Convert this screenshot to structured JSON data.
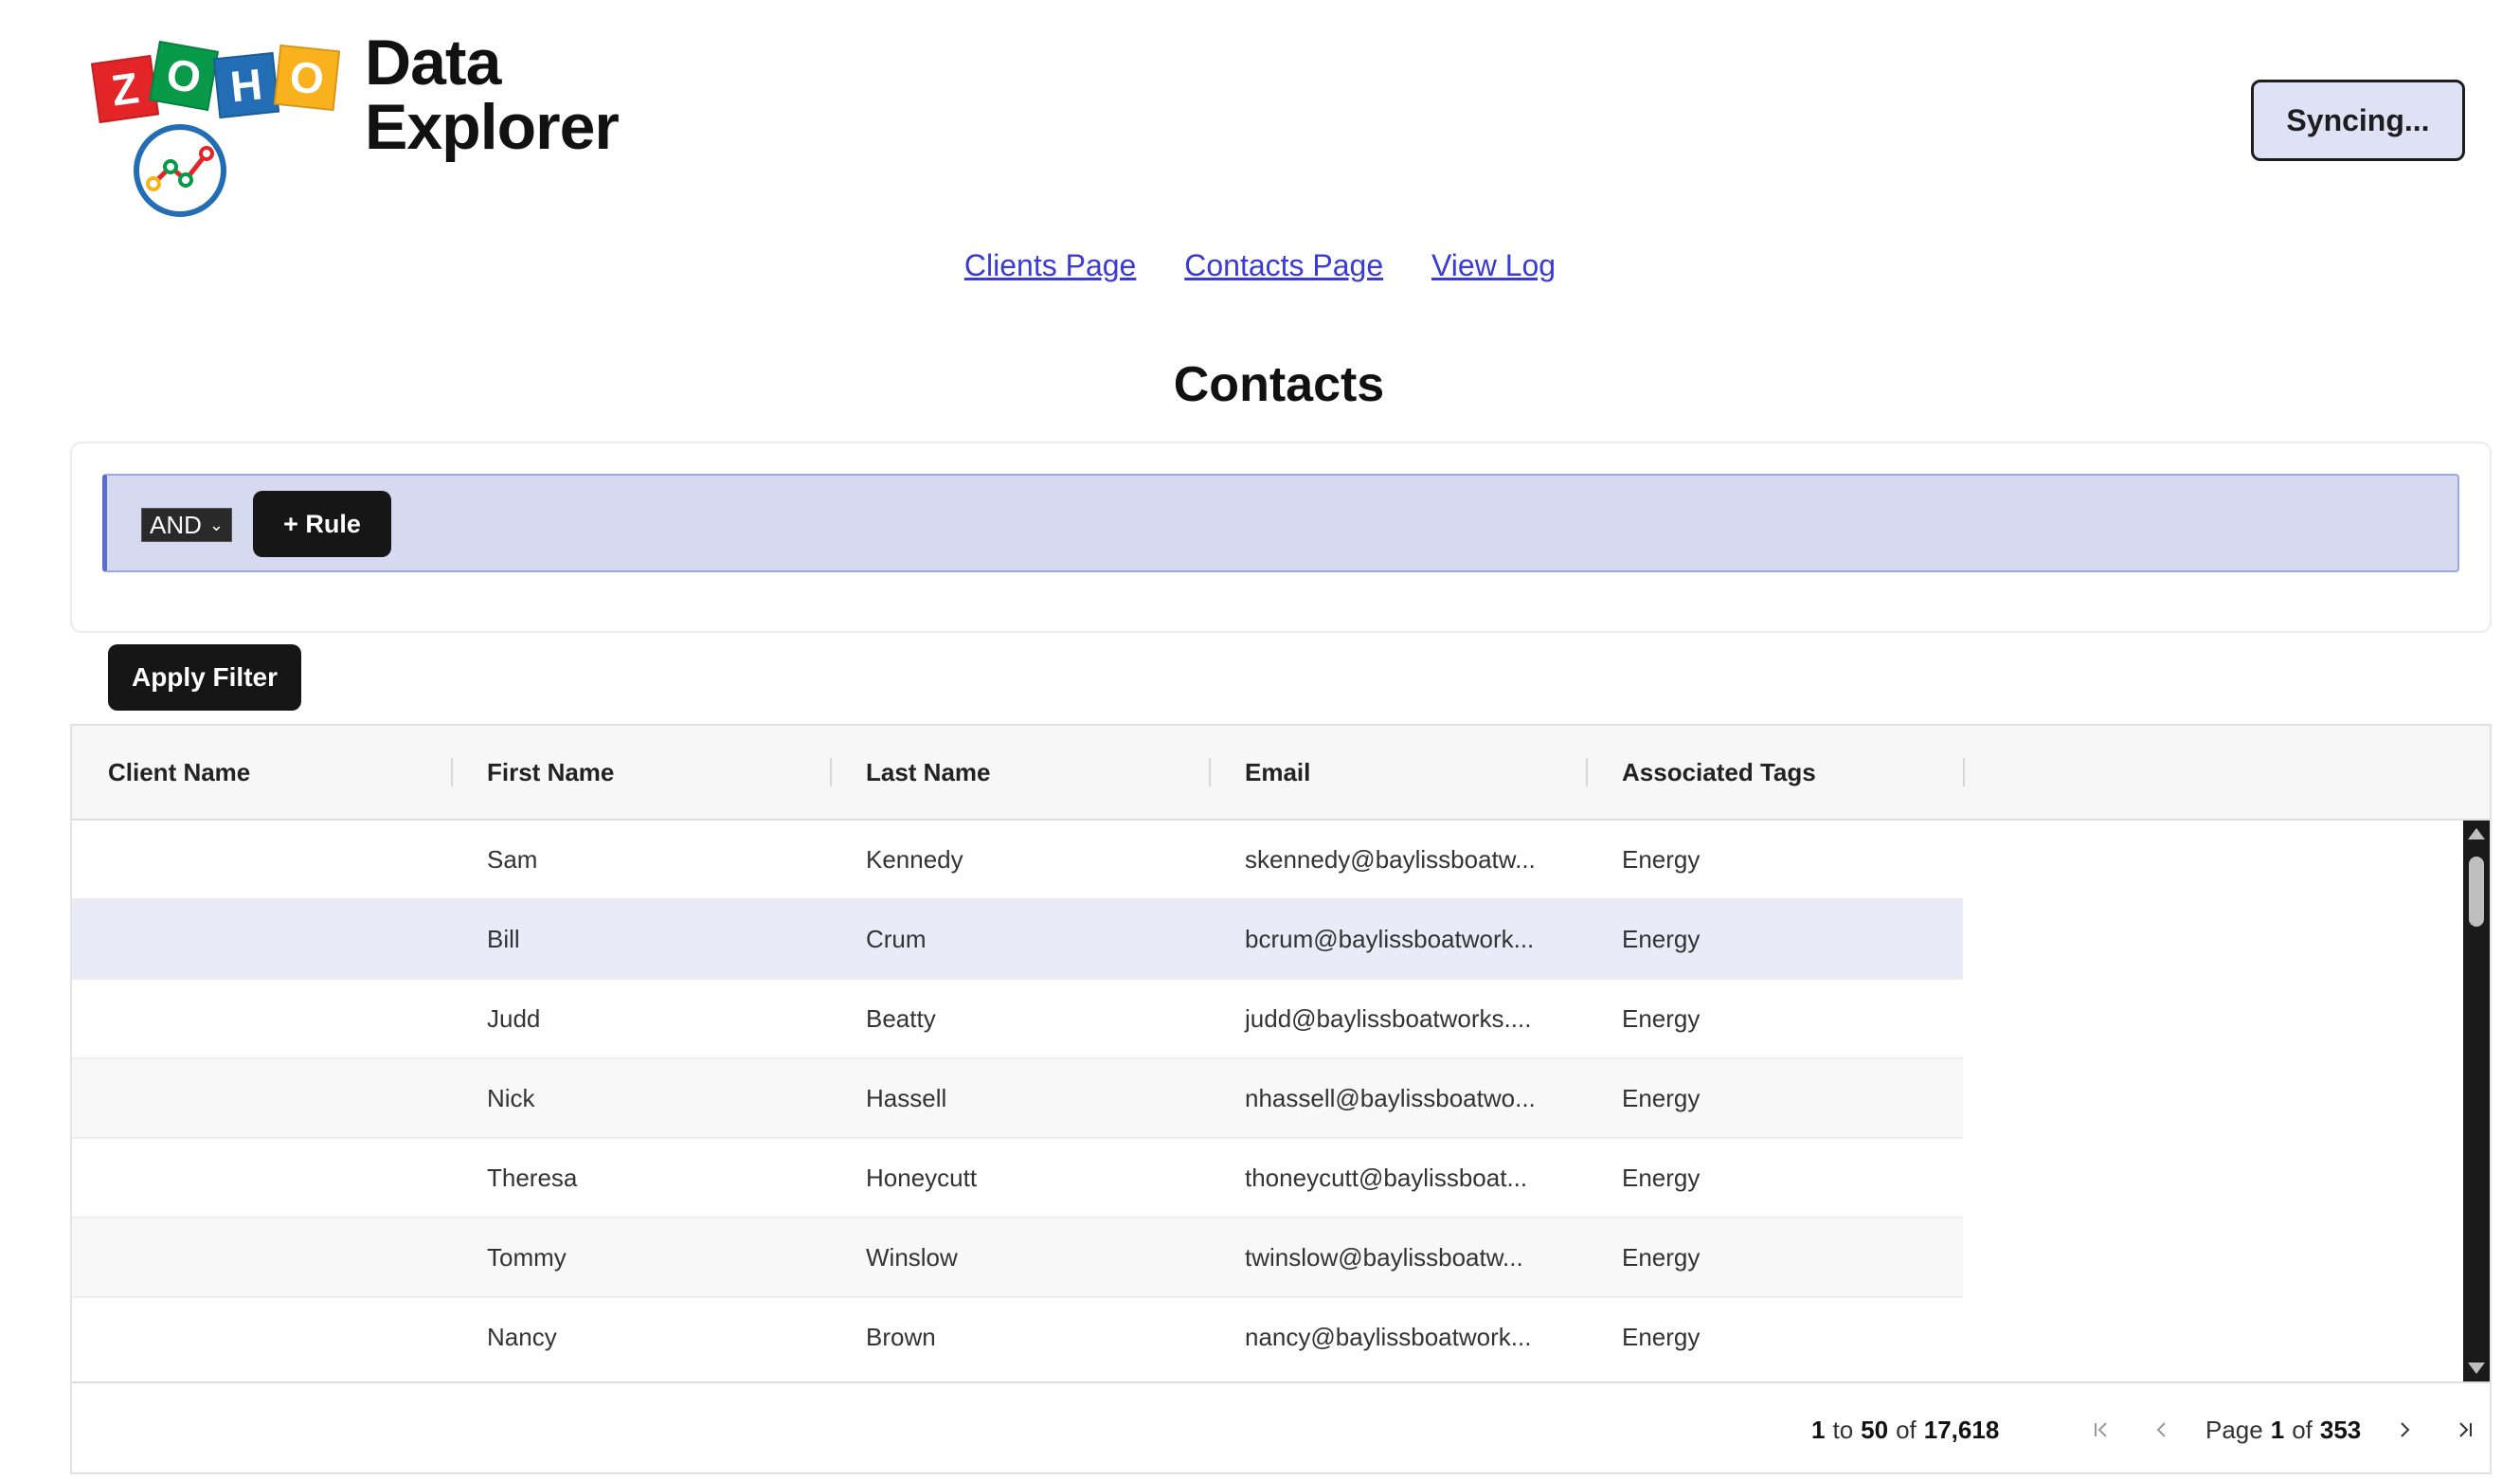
{
  "logo": {
    "zoho_letters": [
      "Z",
      "O",
      "H",
      "O"
    ],
    "zoho_colors": [
      "#e42527",
      "#089949",
      "#226db4",
      "#f9b21d"
    ],
    "title_line1": "Data",
    "title_line2": "Explorer",
    "chart_icon": "chart-line-icon"
  },
  "sync_button": {
    "label": "Syncing..."
  },
  "nav": {
    "links": [
      "Clients Page",
      "Contacts Page",
      "View Log"
    ]
  },
  "page_title": "Contacts",
  "filter": {
    "operator": "AND",
    "add_rule_label": "+ Rule",
    "apply_label": "Apply Filter"
  },
  "table": {
    "columns": [
      "Client Name",
      "First Name",
      "Last Name",
      "Email",
      "Associated Tags"
    ],
    "rows": [
      [
        "",
        "Sam",
        "Kennedy",
        "skennedy@baylissboatw...",
        "Energy"
      ],
      [
        "",
        "Bill",
        "Crum",
        "bcrum@baylissboatwork...",
        "Energy"
      ],
      [
        "",
        "Judd",
        "Beatty",
        "judd@baylissboatworks....",
        "Energy"
      ],
      [
        "",
        "Nick",
        "Hassell",
        "nhassell@baylissboatwo...",
        "Energy"
      ],
      [
        "",
        "Theresa",
        "Honeycutt",
        "thoneycutt@baylissboat...",
        "Energy"
      ],
      [
        "",
        "Tommy",
        "Winslow",
        "twinslow@baylissboatw...",
        "Energy"
      ],
      [
        "",
        "Nancy",
        "Brown",
        "nancy@baylissboatwork...",
        "Energy"
      ]
    ],
    "highlighted_row": 1
  },
  "pagination": {
    "range_start": "1",
    "range_to": "to",
    "range_end": "50",
    "range_of": "of",
    "total": "17,618",
    "page_word": "Page",
    "current_page": "1",
    "page_of": "of",
    "total_pages": "353",
    "icons": [
      "first-page-icon",
      "prev-page-icon",
      "next-page-icon",
      "last-page-icon"
    ]
  },
  "colors": {
    "accent": "#5b6bd4",
    "rule_bar_bg": "#d6daf0",
    "sync_bg": "#dfe2f5",
    "link": "#3a3ad6",
    "button_dark": "#161616"
  }
}
